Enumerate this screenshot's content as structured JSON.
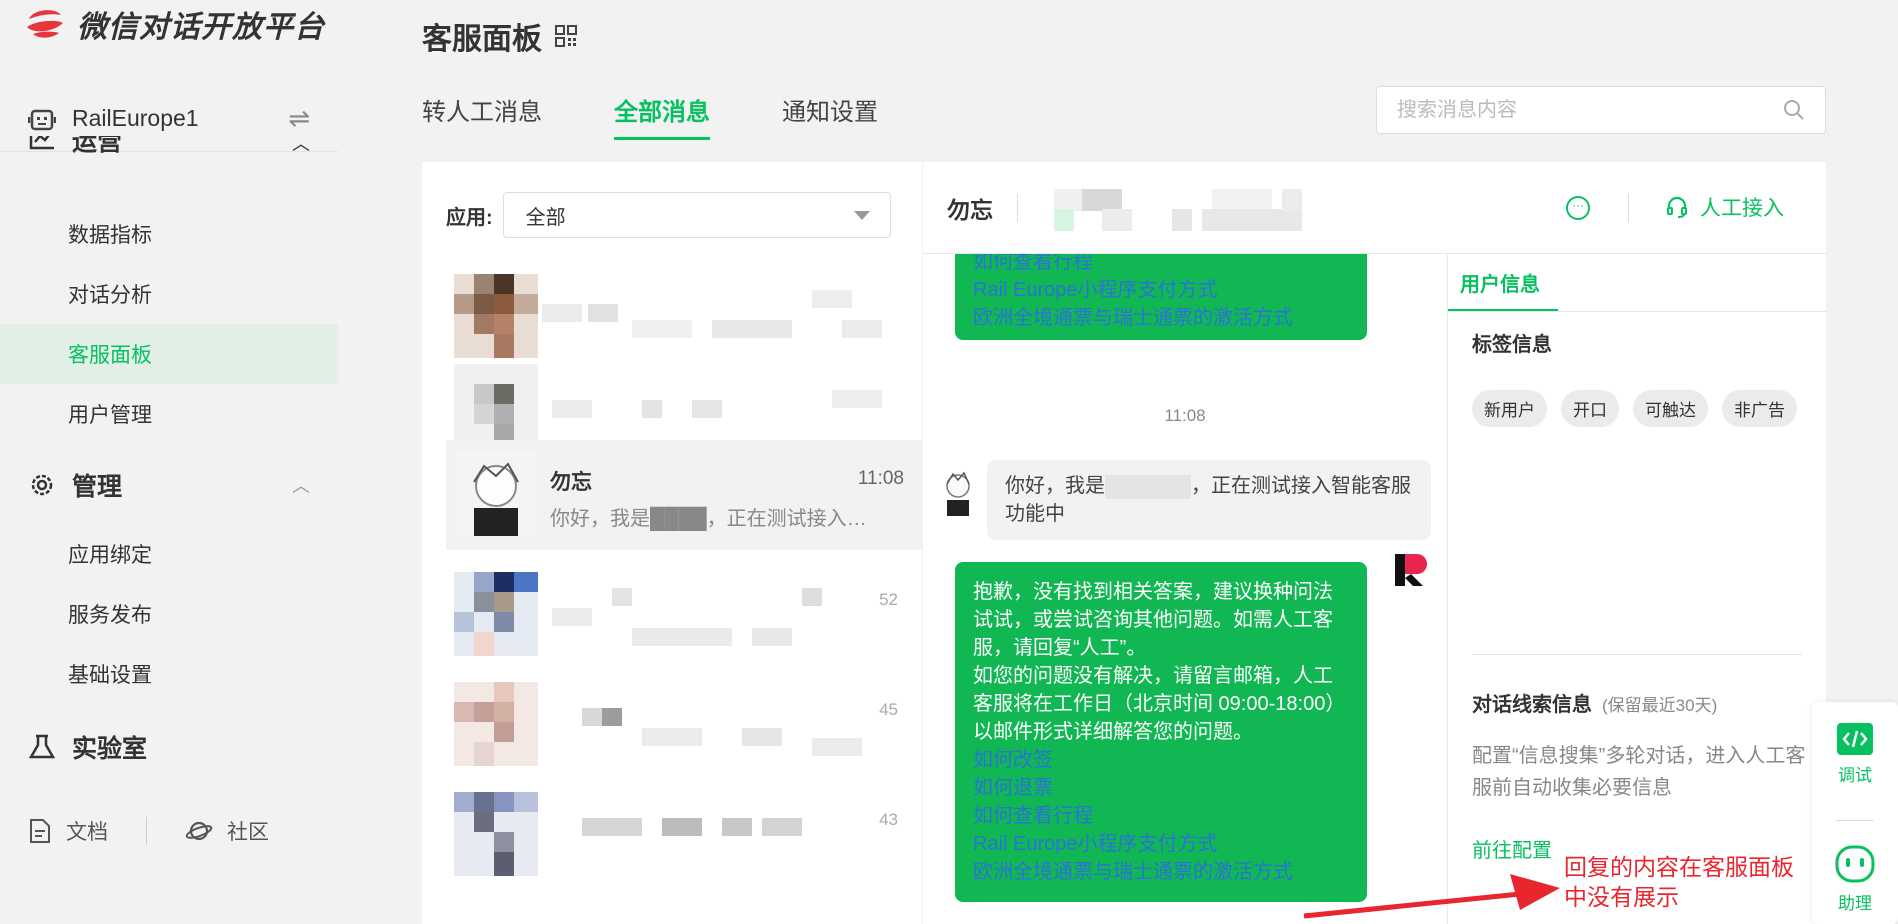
{
  "brand": {
    "name": "微信对话开放平台"
  },
  "account": {
    "name": "RailEurope1",
    "switch_icon": "⇌"
  },
  "sidebar": {
    "groups": [
      {
        "label": "运营",
        "items": [
          "数据指标",
          "对话分析",
          "客服面板",
          "用户管理"
        ]
      },
      {
        "label": "管理",
        "items": [
          "应用绑定",
          "服务发布",
          "基础设置"
        ]
      },
      {
        "label": "实验室",
        "items": []
      }
    ],
    "active_item": "客服面板",
    "bottom": {
      "docs": "文档",
      "community": "社区"
    }
  },
  "header": {
    "title": "客服面板",
    "tabs": [
      "转人工消息",
      "全部消息",
      "通知设置"
    ],
    "active_tab": "全部消息",
    "search_placeholder": "搜索消息内容"
  },
  "list": {
    "filter_label": "应用:",
    "filter_value": "全部",
    "conversations": [
      {
        "time": ""
      },
      {
        "time": ""
      },
      {
        "name": "勿忘",
        "time": "11:08",
        "preview": "你好，我是████，正在测试接入智能客服功能中",
        "active": true
      },
      {
        "time": "52"
      },
      {
        "time": "45"
      },
      {
        "time": "43"
      }
    ]
  },
  "chat": {
    "user_name": "勿忘",
    "manual_label": "人工接入",
    "top_bubble_links": [
      "如何查看行程",
      "Rail Europe小程序支付方式",
      "欧洲全境通票与瑞士通票的激活方式"
    ],
    "timestamp": "11:08",
    "user_msg_prefix": "你好，我是",
    "user_msg_suffix": "，正在测试接入智能客服功能中",
    "bot_reply": "抱歉，没有找到相关答案，建议换种问法试试，或尝试咨询其他问题。如需人工客服，请回复“人工”。",
    "bot_reply2": "如您的问题没有解决，请留言邮箱，人工客服将在工作日（北京时间 09:00-18:00）以邮件形式详细解答您的问题。",
    "bot_links": [
      "如何改签",
      "如何退票",
      "如何查看行程",
      "Rail Europe小程序支付方式",
      "欧洲全境通票与瑞士通票的激活方式"
    ]
  },
  "info": {
    "tab": "用户信息",
    "tag_title": "标签信息",
    "tags": [
      "新用户",
      "开口",
      "可触达",
      "非广告"
    ],
    "clue_title": "对话线索信息",
    "clue_sub": "(保留最近30天)",
    "clue_desc": "配置“信息搜集”多轮对话，进入人工客服前自动收集必要信息",
    "goto": "前往配置"
  },
  "float_bar": {
    "debug": "调试",
    "assistant": "助理"
  },
  "annotation": "回复的内容在客服面板中没有展示",
  "colors": {
    "accent": "#07c160",
    "bubble": "#11b753",
    "link": "#2a73d8",
    "annotation": "#e8262d"
  }
}
